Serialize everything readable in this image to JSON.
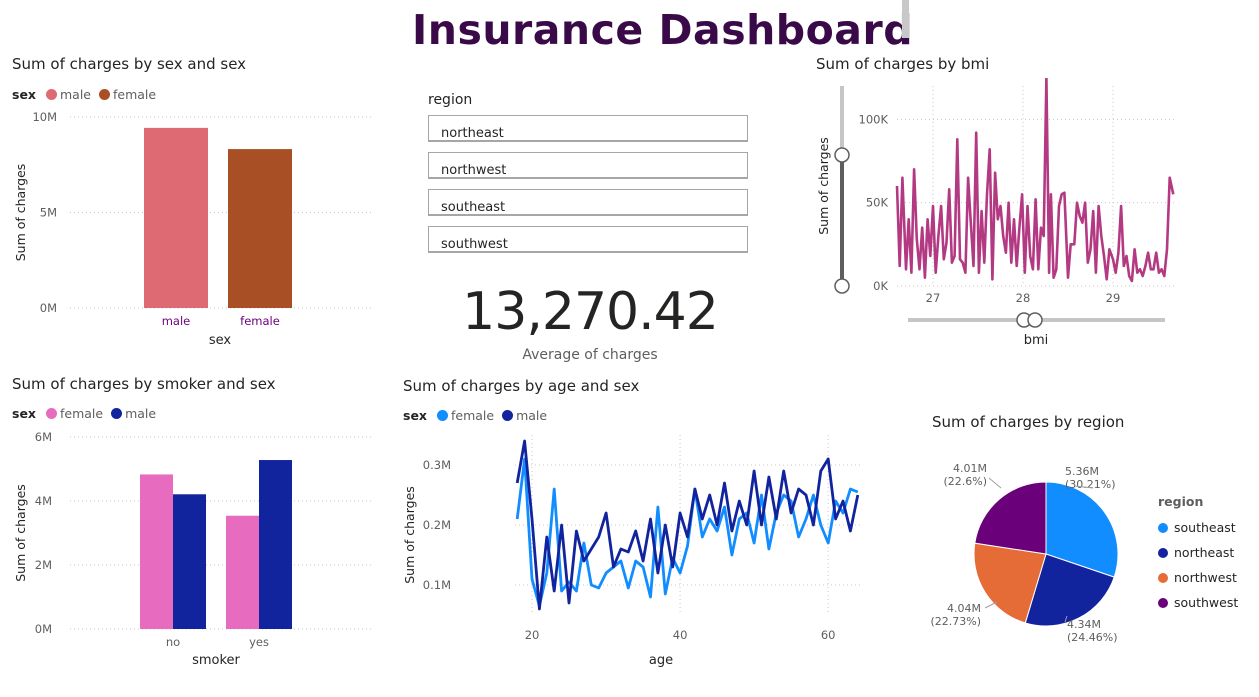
{
  "dashboard": {
    "title": "Insurance Dashboard"
  },
  "colors": {
    "male_pink": "#de6a73",
    "female_brown": "#a94f25",
    "female_pink": "#e76bbf",
    "male_navy": "#12239e",
    "light_blue": "#118dff",
    "navy": "#12239e",
    "orange": "#e66c37",
    "purple": "#6b007b",
    "bmi_line": "#b33a82"
  },
  "chart_sex": {
    "title": "Sum of charges by sex and sex",
    "legend_title": "sex",
    "legend": [
      "male",
      "female"
    ]
  },
  "slicer": {
    "title": "region",
    "items": [
      "northeast",
      "northwest",
      "southeast",
      "southwest"
    ]
  },
  "card": {
    "value": "13,270.42",
    "label": "Average of charges"
  },
  "chart_bmi": {
    "title": "Sum of charges by bmi"
  },
  "chart_smoker": {
    "title": "Sum of charges by smoker and sex",
    "legend_title": "sex",
    "legend": [
      "female",
      "male"
    ]
  },
  "chart_age": {
    "title": "Sum of charges by age and sex",
    "legend_title": "sex",
    "legend": [
      "female",
      "male"
    ]
  },
  "chart_region": {
    "title": "Sum of charges by region",
    "legend_title": "region",
    "legend": [
      "southeast",
      "northeast",
      "northwest",
      "southwest"
    ]
  },
  "chart_data": [
    {
      "type": "bar",
      "title": "Sum of charges by sex and sex",
      "categories": [
        "male",
        "female"
      ],
      "values": [
        9.43,
        8.32
      ],
      "xlabel": "sex",
      "ylabel": "Sum of charges",
      "ylim": [
        0,
        10
      ],
      "yticks": [
        "0M",
        "5M",
        "10M"
      ],
      "ytick_values": [
        0,
        5,
        10
      ],
      "grid": true
    },
    {
      "type": "bar",
      "title": "Sum of charges by smoker and sex",
      "categories": [
        "no",
        "yes"
      ],
      "series": [
        {
          "name": "female",
          "values": [
            4.83,
            3.54
          ]
        },
        {
          "name": "male",
          "values": [
            4.21,
            5.28
          ]
        }
      ],
      "xlabel": "smoker",
      "ylabel": "Sum of charges",
      "ylim": [
        0,
        6
      ],
      "yticks": [
        "0M",
        "2M",
        "4M",
        "6M"
      ],
      "ytick_values": [
        0,
        2,
        4,
        6
      ],
      "grid": true
    },
    {
      "type": "line",
      "title": "Sum of charges by bmi",
      "xlabel": "bmi",
      "ylabel": "Sum of charges",
      "xlim": [
        26.6,
        29.7
      ],
      "ylim": [
        0,
        120
      ],
      "xticks": [
        "27",
        "28",
        "29"
      ],
      "xtick_values": [
        27,
        28,
        29
      ],
      "yticks": [
        "0K",
        "50K",
        "100K"
      ],
      "ytick_values": [
        0,
        50,
        100
      ],
      "x": [
        26.6,
        26.63,
        26.66,
        26.7,
        26.73,
        26.76,
        26.79,
        26.82,
        26.85,
        26.88,
        26.91,
        26.94,
        26.97,
        27.0,
        27.03,
        27.06,
        27.09,
        27.12,
        27.15,
        27.18,
        27.21,
        27.24,
        27.27,
        27.3,
        27.33,
        27.36,
        27.39,
        27.42,
        27.45,
        27.48,
        27.51,
        27.54,
        27.57,
        27.6,
        27.63,
        27.66,
        27.69,
        27.72,
        27.75,
        27.78,
        27.81,
        27.84,
        27.87,
        27.9,
        27.93,
        27.96,
        27.99,
        28.02,
        28.05,
        28.08,
        28.11,
        28.14,
        28.17,
        28.2,
        28.23,
        28.26,
        28.29,
        28.31,
        28.34,
        28.37,
        28.4,
        28.43,
        28.46,
        28.5,
        28.53,
        28.57,
        28.6,
        28.63,
        28.66,
        28.69,
        28.72,
        28.75,
        28.78,
        28.81,
        28.84,
        28.87,
        28.9,
        28.93,
        28.96,
        29.0,
        29.03,
        29.06,
        29.09,
        29.12,
        29.15,
        29.18,
        29.21,
        29.24,
        29.27,
        29.3,
        29.33,
        29.36,
        29.39,
        29.42,
        29.45,
        29.48,
        29.51,
        29.54,
        29.57,
        29.6,
        29.63,
        29.67
      ],
      "y": [
        60,
        12,
        65,
        10,
        40,
        8,
        70,
        28,
        10,
        35,
        5,
        40,
        18,
        48,
        8,
        30,
        48,
        16,
        26,
        58,
        14,
        18,
        88,
        16,
        14,
        8,
        65,
        38,
        12,
        92,
        8,
        45,
        14,
        55,
        82,
        4,
        68,
        40,
        48,
        30,
        20,
        50,
        14,
        40,
        12,
        35,
        55,
        8,
        48,
        18,
        10,
        52,
        10,
        35,
        30,
        125,
        8,
        55,
        5,
        10,
        48,
        55,
        56,
        5,
        25,
        25,
        50,
        42,
        38,
        50,
        14,
        22,
        45,
        8,
        48,
        30,
        18,
        4,
        22,
        16,
        8,
        20,
        48,
        12,
        18,
        6,
        3,
        22,
        8,
        10,
        6,
        12,
        20,
        10,
        10,
        20,
        8,
        10,
        6,
        22,
        65,
        55
      ]
    },
    {
      "type": "line",
      "title": "Sum of charges by age and sex",
      "xlabel": "age",
      "ylabel": "Sum of charges",
      "xlim": [
        17.7,
        64.3
      ],
      "ylim": [
        0.05,
        0.35
      ],
      "xticks": [
        "20",
        "40",
        "60"
      ],
      "xtick_values": [
        20,
        40,
        60
      ],
      "yticks": [
        "0.1M",
        "0.2M",
        "0.3M"
      ],
      "ytick_values": [
        0.1,
        0.2,
        0.3
      ],
      "x": [
        18,
        19,
        20,
        21,
        22,
        23,
        24,
        25,
        26,
        27,
        28,
        29,
        30,
        31,
        32,
        33,
        34,
        35,
        36,
        37,
        38,
        39,
        40,
        41,
        42,
        43,
        44,
        45,
        46,
        47,
        48,
        49,
        50,
        51,
        52,
        53,
        54,
        55,
        56,
        57,
        58,
        59,
        60,
        61,
        62,
        63,
        64
      ],
      "series": [
        {
          "name": "female",
          "values": [
            0.21,
            0.31,
            0.11,
            0.065,
            0.12,
            0.26,
            0.09,
            0.105,
            0.09,
            0.17,
            0.1,
            0.095,
            0.12,
            0.13,
            0.14,
            0.095,
            0.14,
            0.13,
            0.08,
            0.23,
            0.085,
            0.145,
            0.12,
            0.165,
            0.26,
            0.18,
            0.21,
            0.19,
            0.23,
            0.15,
            0.21,
            0.22,
            0.17,
            0.25,
            0.16,
            0.22,
            0.25,
            0.24,
            0.18,
            0.21,
            0.25,
            0.2,
            0.17,
            0.24,
            0.22,
            0.26,
            0.255
          ]
        },
        {
          "name": "male",
          "values": [
            0.27,
            0.34,
            0.21,
            0.06,
            0.18,
            0.09,
            0.2,
            0.07,
            0.19,
            0.14,
            0.16,
            0.18,
            0.22,
            0.13,
            0.16,
            0.155,
            0.19,
            0.14,
            0.21,
            0.12,
            0.2,
            0.13,
            0.22,
            0.18,
            0.26,
            0.21,
            0.25,
            0.2,
            0.27,
            0.19,
            0.24,
            0.2,
            0.29,
            0.2,
            0.28,
            0.21,
            0.29,
            0.22,
            0.26,
            0.25,
            0.2,
            0.29,
            0.31,
            0.21,
            0.24,
            0.19,
            0.25
          ]
        }
      ]
    },
    {
      "type": "pie",
      "title": "Sum of charges by region",
      "categories": [
        "southeast",
        "northeast",
        "northwest",
        "southwest"
      ],
      "values": [
        5.36,
        4.34,
        4.04,
        4.01
      ],
      "labels": [
        "5.36M\n(30.21%)",
        "4.34M\n(24.46%)",
        "4.04M\n(22.73%)",
        "4.01M\n(22.6%)"
      ],
      "legend": "right"
    }
  ]
}
